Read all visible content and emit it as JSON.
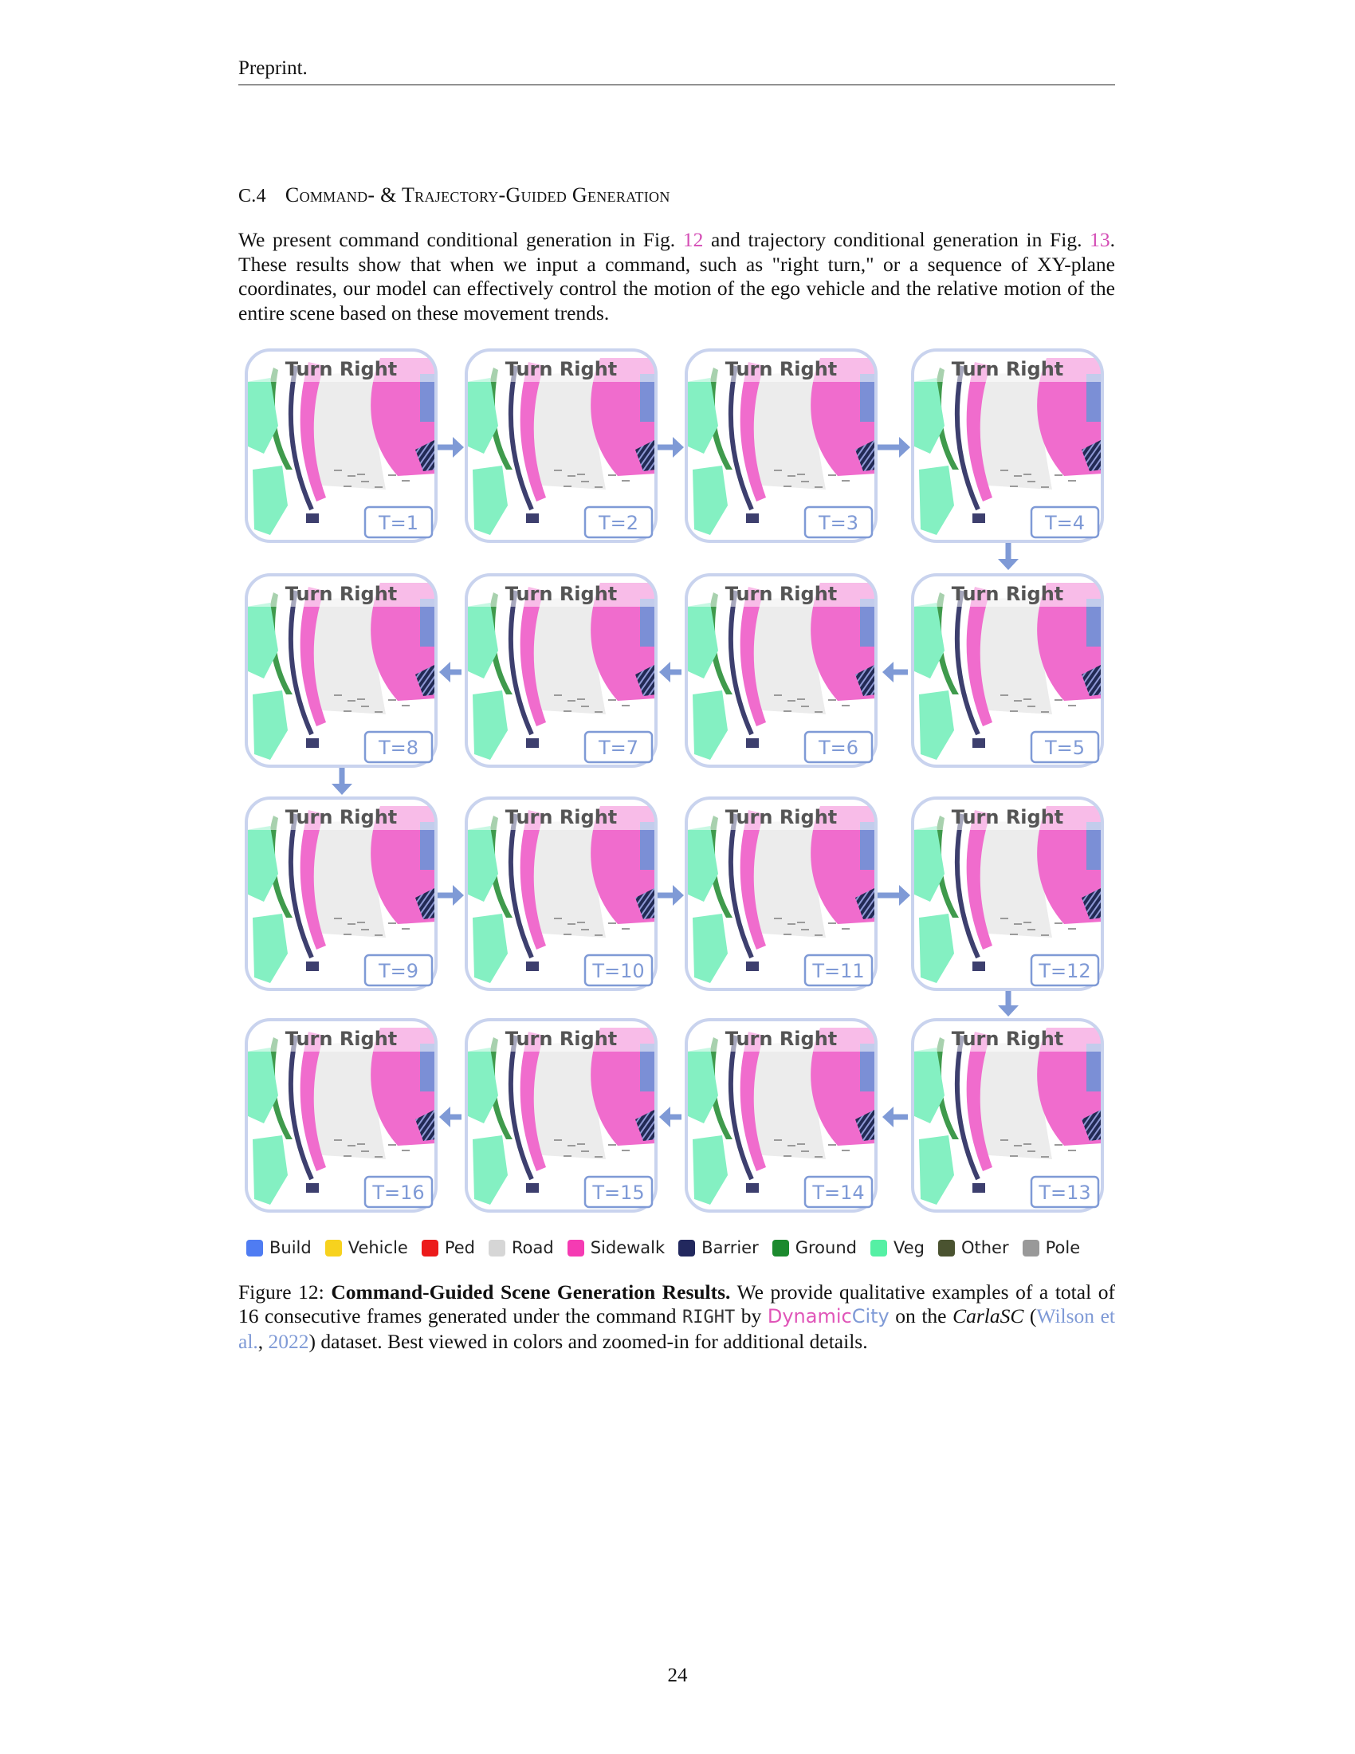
{
  "header": {
    "text": "Preprint."
  },
  "section": {
    "number": "C.4",
    "title": "Command- & Trajectory-Guided Generation"
  },
  "intro": {
    "t1": "We present command conditional generation in Fig. ",
    "ref1": "12",
    "t2": " and trajectory conditional generation in Fig. ",
    "ref2": "13",
    "t3": ". These results show that when we input a command, such as \"right turn,\" or a sequence of XY-plane coordinates, our model can effectively control the motion of the ego vehicle and the relative motion of the entire scene based on these movement trends."
  },
  "figure": {
    "command_label": "Turn Right",
    "frames": [
      {
        "label": "T=1"
      },
      {
        "label": "T=2"
      },
      {
        "label": "T=3"
      },
      {
        "label": "T=4"
      },
      {
        "label": "T=8"
      },
      {
        "label": "T=7"
      },
      {
        "label": "T=6"
      },
      {
        "label": "T=5"
      },
      {
        "label": "T=9"
      },
      {
        "label": "T=10"
      },
      {
        "label": "T=11"
      },
      {
        "label": "T=12"
      },
      {
        "label": "T=16"
      },
      {
        "label": "T=15"
      },
      {
        "label": "T=14"
      },
      {
        "label": "T=13"
      }
    ],
    "colors": {
      "frame_border": "#c9d3ee",
      "arrow": "#7f9ad6",
      "road": "#ececec",
      "sidewalk": "#f06ccd",
      "veg": "#84f0c2",
      "ground": "#3f9a4c",
      "barrier": "#3d3f6e",
      "build": "#7b8fd6"
    }
  },
  "legend": [
    {
      "label": "Build",
      "color": "#4f7cf2"
    },
    {
      "label": "Vehicle",
      "color": "#f7d21e"
    },
    {
      "label": "Ped",
      "color": "#ec1b1b"
    },
    {
      "label": "Road",
      "color": "#d6d6d6"
    },
    {
      "label": "Sidewalk",
      "color": "#f53bb3"
    },
    {
      "label": "Barrier",
      "color": "#22285e"
    },
    {
      "label": "Ground",
      "color": "#1c8a2e"
    },
    {
      "label": "Veg",
      "color": "#55f0a4"
    },
    {
      "label": "Other",
      "color": "#4a5330"
    },
    {
      "label": "Pole",
      "color": "#999999"
    }
  ],
  "caption": {
    "label": "Figure 12: ",
    "title": "Command-Guided Scene Generation Results.",
    "t1": " We provide qualitative examples of a total of 16 consecutive frames generated under the command ",
    "command": "RIGHT",
    "t2": " by ",
    "name_a": "Dynamic",
    "name_b": "City",
    "t3": " on the ",
    "dataset": "CarlaSC",
    "t4": " (",
    "cite_author": "Wilson et al.",
    "t5": ", ",
    "cite_year": "2022",
    "t6": ") dataset. Best viewed in colors and zoomed-in for additional details."
  },
  "page_number": "24"
}
